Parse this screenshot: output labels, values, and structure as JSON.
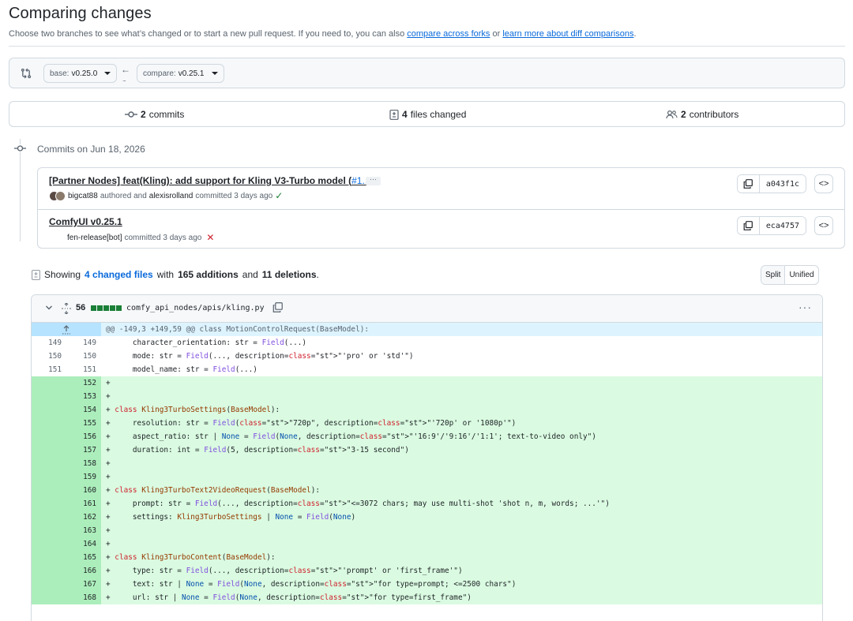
{
  "page": {
    "title": "Comparing changes",
    "subtitle_prefix": "Choose two branches to see what’s changed or to start a new pull request. If you need to, you can also ",
    "link_compare_forks": "compare across forks",
    "subtitle_or": " or ",
    "link_learn_more": "learn more about diff comparisons",
    "subtitle_suffix": "."
  },
  "range": {
    "base_label": "base:",
    "base_value": "v0.25.0",
    "compare_label": "compare:",
    "compare_value": "v0.25.1",
    "arrow": "←",
    "dots": "..."
  },
  "summary": {
    "commits_count": "2",
    "commits_label": "commits",
    "files_count": "4",
    "files_label": "files changed",
    "contributors_count": "2",
    "contributors_label": "contributors"
  },
  "commits": {
    "heading": "Commits on Jun 18, 2026",
    "items": [
      {
        "title": "[Partner Nodes] feat(Kling): add support for Kling V3-Turbo model (",
        "pr": "#1...",
        "more": "···",
        "author": "bigcat88",
        "authored": "authored and",
        "committer": "alexisrolland",
        "committed": "committed 3 days ago",
        "status": "✓",
        "status_color": "#1a7f37",
        "sha": "a043f1c"
      },
      {
        "title": "ComfyUI v0.25.1",
        "author": "fen-release[bot]",
        "committed": "committed 3 days ago",
        "status": "✕",
        "status_color": "#cf222e",
        "sha": "eca4757"
      }
    ]
  },
  "showing": {
    "prefix": "Showing",
    "changed_files": "4 changed files",
    "with": "with",
    "additions": "165 additions",
    "and": "and",
    "deletions": "11 deletions",
    "end": "."
  },
  "view_toggle": {
    "split": "Split",
    "unified": "Unified"
  },
  "file": {
    "count": "56",
    "path": "comfy_api_nodes/apis/kling.py",
    "more": "···",
    "hunk": "@@ -149,3 +149,59 @@ class MotionControlRequest(BaseModel):"
  },
  "diff_lines": [
    {
      "old": "149",
      "new": "149",
      "sign": " ",
      "code": "    character_orientation: str = Field(...)"
    },
    {
      "old": "150",
      "new": "150",
      "sign": " ",
      "code": "    mode: str = Field(..., description=\"'pro' or 'std'\")"
    },
    {
      "old": "151",
      "new": "151",
      "sign": " ",
      "code": "    model_name: str = Field(...)"
    },
    {
      "old": "",
      "new": "152",
      "sign": "+",
      "code": ""
    },
    {
      "old": "",
      "new": "153",
      "sign": "+",
      "code": ""
    },
    {
      "old": "",
      "new": "154",
      "sign": "+",
      "code": "class Kling3TurboSettings(BaseModel):"
    },
    {
      "old": "",
      "new": "155",
      "sign": "+",
      "code": "    resolution: str = Field(\"720p\", description=\"'720p' or '1080p'\")"
    },
    {
      "old": "",
      "new": "156",
      "sign": "+",
      "code": "    aspect_ratio: str | None = Field(None, description=\"'16:9'/'9:16'/'1:1'; text-to-video only\")"
    },
    {
      "old": "",
      "new": "157",
      "sign": "+",
      "code": "    duration: int = Field(5, description=\"3-15 second\")"
    },
    {
      "old": "",
      "new": "158",
      "sign": "+",
      "code": ""
    },
    {
      "old": "",
      "new": "159",
      "sign": "+",
      "code": ""
    },
    {
      "old": "",
      "new": "160",
      "sign": "+",
      "code": "class Kling3TurboText2VideoRequest(BaseModel):"
    },
    {
      "old": "",
      "new": "161",
      "sign": "+",
      "code": "    prompt: str = Field(..., description=\"<=3072 chars; may use multi-shot 'shot n, m, words; ...'\")"
    },
    {
      "old": "",
      "new": "162",
      "sign": "+",
      "code": "    settings: Kling3TurboSettings | None = Field(None)"
    },
    {
      "old": "",
      "new": "163",
      "sign": "+",
      "code": ""
    },
    {
      "old": "",
      "new": "164",
      "sign": "+",
      "code": ""
    },
    {
      "old": "",
      "new": "165",
      "sign": "+",
      "code": "class Kling3TurboContent(BaseModel):"
    },
    {
      "old": "",
      "new": "166",
      "sign": "+",
      "code": "    type: str = Field(..., description=\"'prompt' or 'first_frame'\")"
    },
    {
      "old": "",
      "new": "167",
      "sign": "+",
      "code": "    text: str | None = Field(None, description=\"for type=prompt; <=2500 chars\")"
    },
    {
      "old": "",
      "new": "168",
      "sign": "+",
      "code": "    url: str | None = Field(None, description=\"for type=first_frame\")"
    }
  ]
}
